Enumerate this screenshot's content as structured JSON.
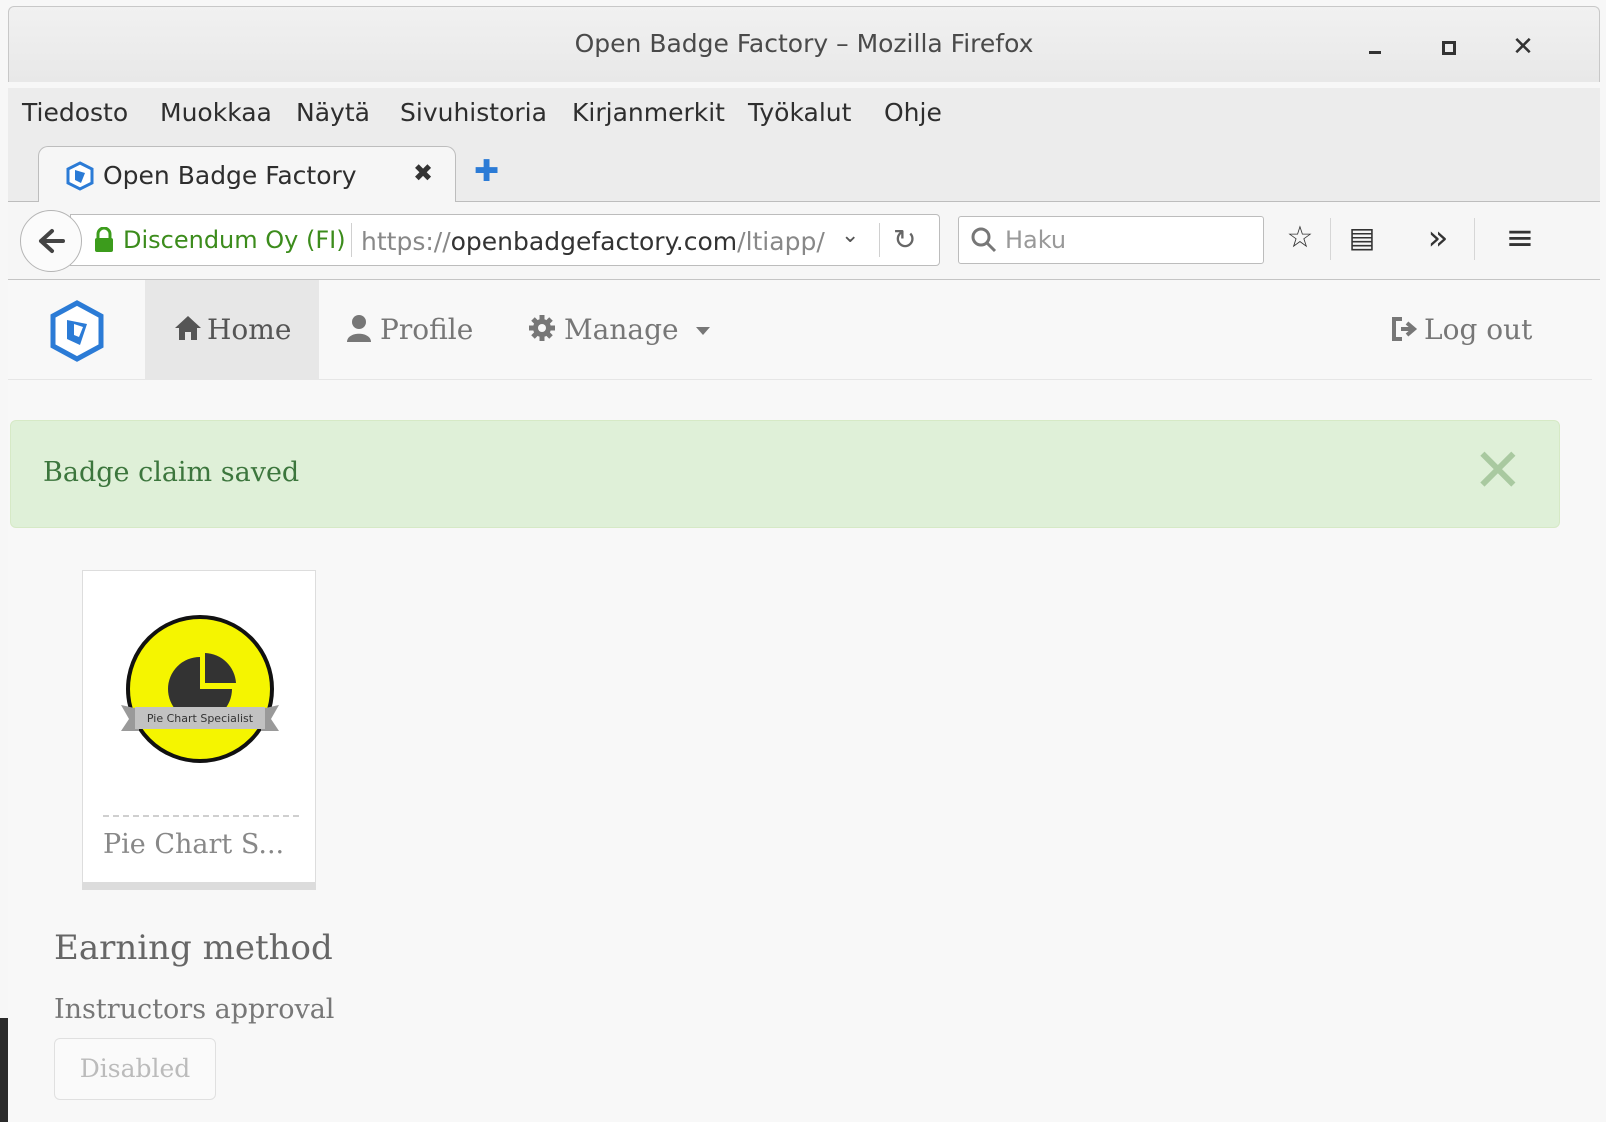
{
  "window": {
    "title": "Open Badge Factory – Mozilla Firefox",
    "minimize_label": "‒",
    "maximize_label": "▫",
    "close_label": "✕"
  },
  "menubar": {
    "items": [
      "Tiedosto",
      "Muokkaa",
      "Näytä",
      "Sivuhistoria",
      "Kirjanmerkit",
      "Työkalut",
      "Ohje"
    ]
  },
  "tabs": {
    "active_title": "Open Badge Factory",
    "close_glyph": "✖",
    "new_tab_glyph": "✚"
  },
  "navbar": {
    "back_glyph": "🡐",
    "site_identity": "Discendum Oy (FI)",
    "url_prefix": "https://",
    "url_host": "openbadgefactory.com",
    "url_path": "/ltiapp/",
    "url_dropdown_glyph": "⌄",
    "reload_glyph": "↻",
    "search_placeholder": "Haku",
    "bookmark_glyph": "☆",
    "reader_glyph": "▤",
    "overflow_glyph": "»",
    "menu_glyph": "≡",
    "icons": [
      "back-icon",
      "lock-icon",
      "reload-icon",
      "search-icon",
      "star-icon",
      "library-icon",
      "overflow-icon",
      "hamburger-menu-icon"
    ]
  },
  "site_nav": {
    "home": "Home",
    "profile": "Profile",
    "manage": "Manage",
    "logout": "Log out",
    "icons": [
      "home-icon",
      "user-icon",
      "gear-icon",
      "caret-down-icon",
      "logout-icon"
    ]
  },
  "alert": {
    "message": "Badge claim saved",
    "close_glyph": "✕"
  },
  "badge": {
    "name": "Pie Chart S...",
    "ribbon_text": "Pie Chart Specialist",
    "colors": {
      "fill": "#f5f500",
      "ring": "#111111",
      "ribbon": "#bdbdbd"
    }
  },
  "earning": {
    "heading": "Earning method",
    "method": "Instructors approval",
    "button": "Disabled"
  },
  "colors": {
    "alert_bg": "#dff0d8",
    "alert_text": "#3c763d",
    "brand_blue": "#2b7bd6",
    "secure_green": "#3c8c1c"
  }
}
